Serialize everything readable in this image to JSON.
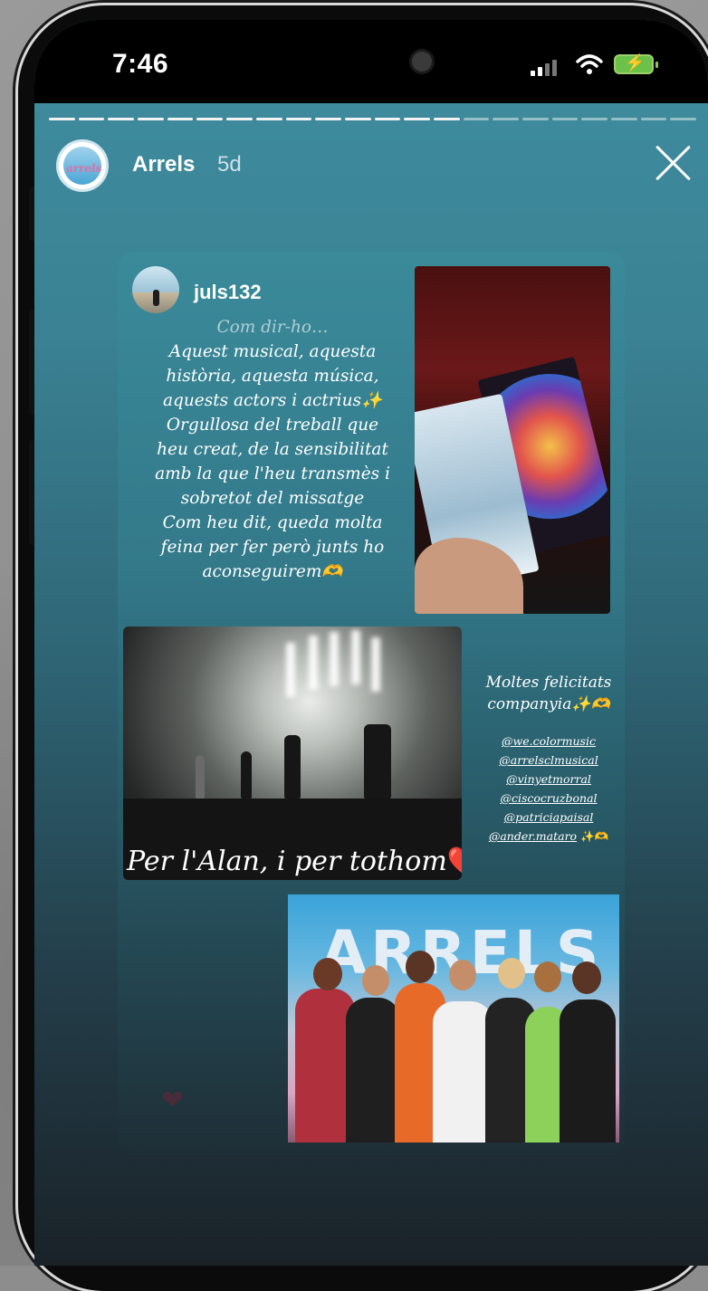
{
  "status_bar": {
    "time": "7:46"
  },
  "story": {
    "username": "Arrels",
    "age": "5d",
    "progress_segments_done": 14,
    "progress_segments_total": 22
  },
  "icons": [
    "close-icon",
    "signal-icon",
    "wifi-icon",
    "battery-charging-icon"
  ],
  "post": {
    "username": "juls132",
    "text_lines": [
      "Com dir-ho…",
      "Aquest musical, aquesta",
      "història, aquesta música,",
      "aquests actors i actrius✨",
      "Orgullosa del treball que",
      "heu creat, de la sensibilitat",
      "amb la que l'heu transmès i",
      "sobretot del missatge",
      "Com heu dit, queda molta",
      "feina per fer però junts ho",
      "aconseguirem🫶"
    ],
    "stage_caption": "Per l'Alan, i per tothom",
    "heart_emoji": "❤️",
    "congrats_lines": [
      "Moltes felicitats",
      "companyia✨🫶"
    ],
    "mentions": [
      "@we.colormusic",
      "@arrelsclmusical",
      "@vinyetmorral",
      "@ciscocruzbonal",
      "@patriciapaisal",
      "@ander.mataro"
    ],
    "mentions_suffix": "✨🫶",
    "poster_text": "ARRELS"
  }
}
